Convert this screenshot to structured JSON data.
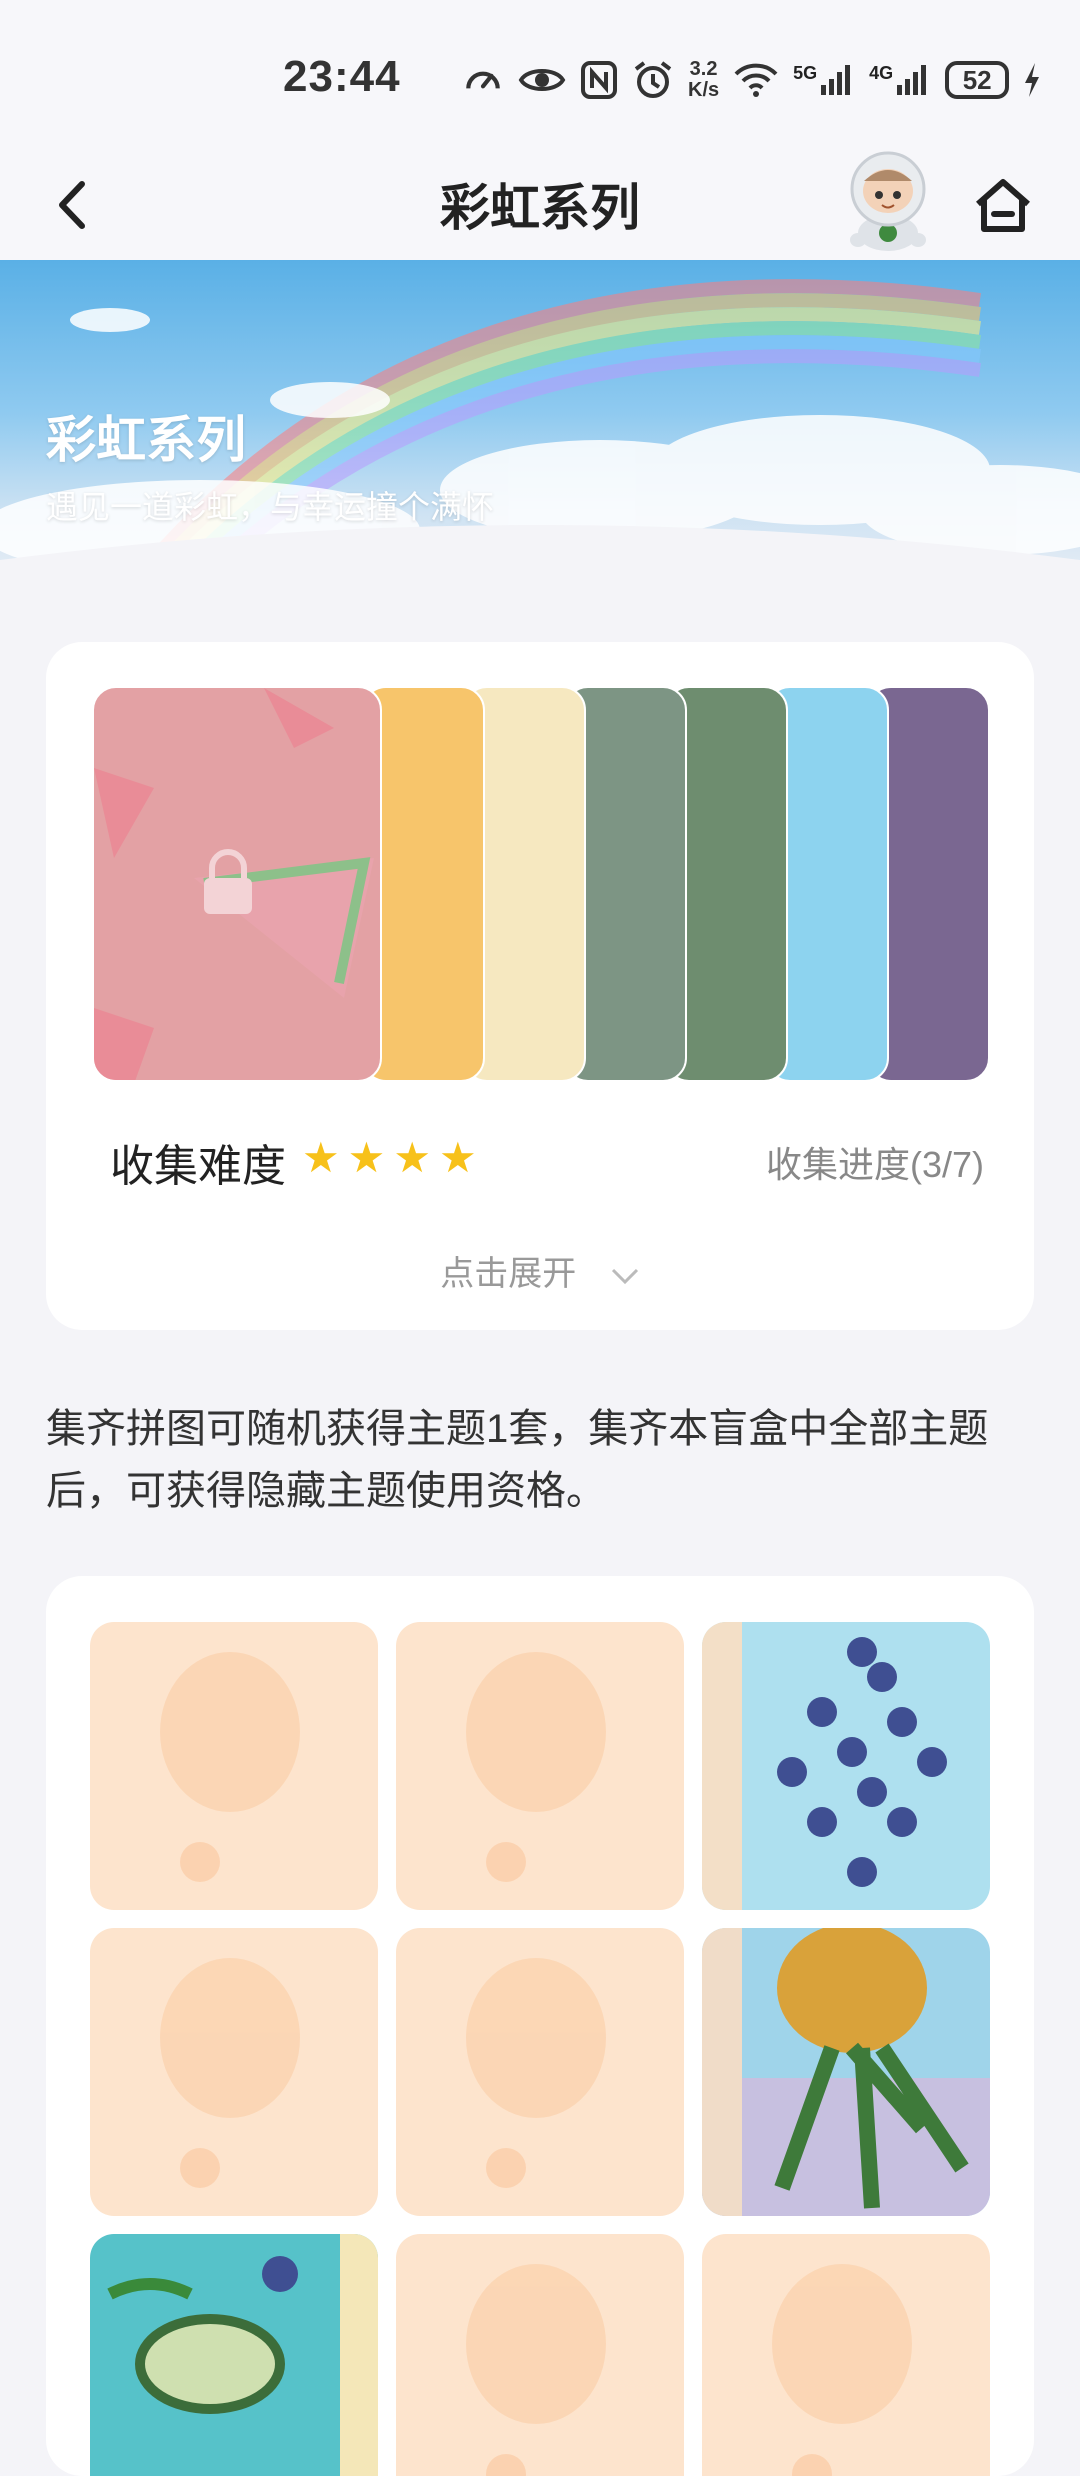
{
  "status_bar": {
    "time": "23:44",
    "speed_value": "3.2",
    "speed_unit": "K/s",
    "signal_5g": "5G",
    "signal_4g": "4G",
    "battery": "52",
    "icons": [
      "speedometer-icon",
      "eye-icon",
      "nfc-icon",
      "alarm-icon",
      "wifi-icon",
      "signal-icon",
      "battery-icon",
      "charging-icon"
    ]
  },
  "nav": {
    "title": "彩虹系列",
    "icons": [
      "back-arrow-icon",
      "astronaut-avatar",
      "home-icon"
    ]
  },
  "banner": {
    "title": "彩虹系列",
    "subtitle": "遇见一道彩虹，与幸运撞个满怀"
  },
  "collection": {
    "themes": [
      {
        "name": "watermelon",
        "color": "#e98a8c",
        "locked": true
      },
      {
        "name": "pineapple",
        "color": "#f7c56b",
        "locked": false
      },
      {
        "name": "lemon",
        "color": "#f6e8c0",
        "locked": false
      },
      {
        "name": "avocado",
        "color": "#7d9584",
        "locked": false
      },
      {
        "name": "leaf",
        "color": "#6e8d6f",
        "locked": false
      },
      {
        "name": "blueberry",
        "color": "#8dd3ef",
        "locked": false
      },
      {
        "name": "grape",
        "color": "#7a6791",
        "locked": false
      }
    ],
    "difficulty_label": "收集难度",
    "difficulty_stars": 4,
    "progress_text": "收集进度(3/7)",
    "expand_label": "点击展开"
  },
  "description": "集齐拼图可随机获得主题1套，集齐本盲盒中全部主题后，可获得隐藏主题使用资格。",
  "puzzle": {
    "pieces": [
      {
        "name": "pineapple-faded",
        "collected": false
      },
      {
        "name": "grapes-faded",
        "collected": false
      },
      {
        "name": "blueberries",
        "collected": true
      },
      {
        "name": "lemon-faded",
        "collected": false
      },
      {
        "name": "watermelon-faded",
        "collected": false
      },
      {
        "name": "pineapple",
        "collected": true
      },
      {
        "name": "avocado",
        "collected": true
      },
      {
        "name": "faded-7",
        "collected": false
      },
      {
        "name": "faded-8",
        "collected": false
      }
    ]
  }
}
